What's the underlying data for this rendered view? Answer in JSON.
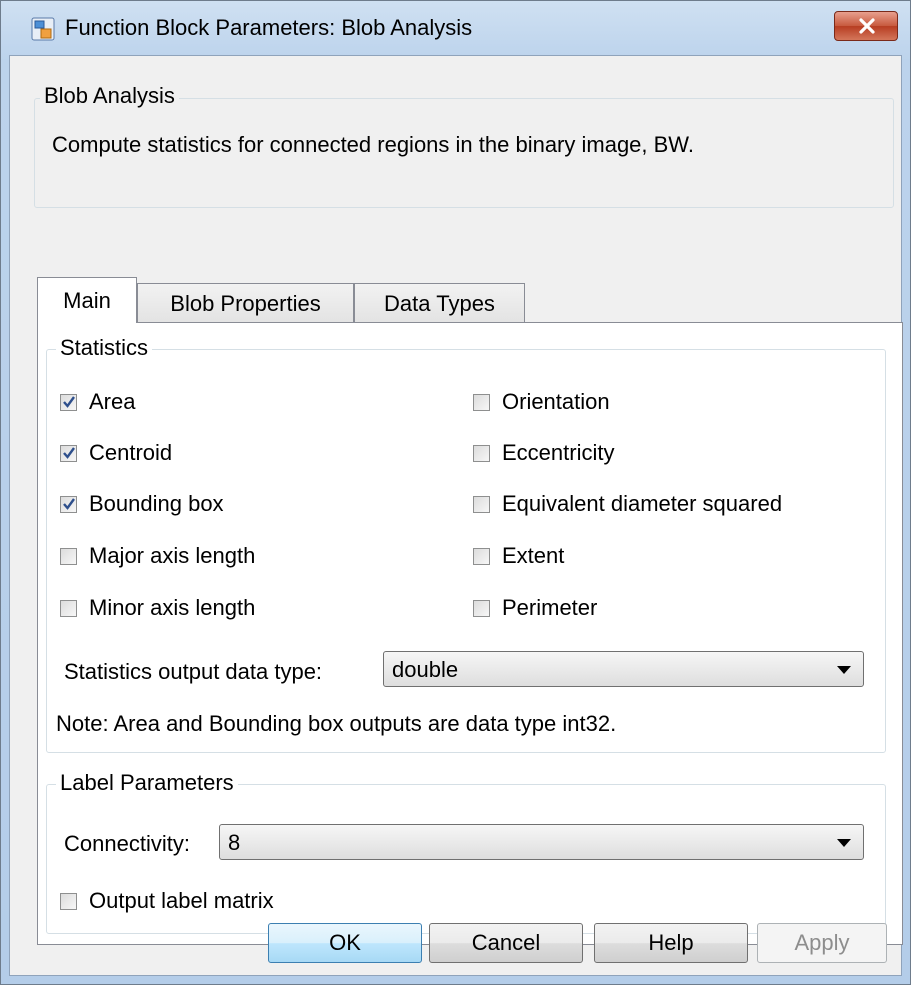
{
  "window": {
    "title": "Function Block Parameters: Blob Analysis",
    "icon": "simulink-block-icon",
    "close_icon": "close-icon"
  },
  "header_group": {
    "legend": "Blob Analysis",
    "description": "Compute statistics for connected regions in the binary image, BW."
  },
  "tabs": [
    {
      "label": "Main",
      "active": true
    },
    {
      "label": "Blob Properties",
      "active": false
    },
    {
      "label": "Data Types",
      "active": false
    }
  ],
  "statistics": {
    "legend": "Statistics",
    "left_column": [
      {
        "label": "Area",
        "checked": true
      },
      {
        "label": "Centroid",
        "checked": true
      },
      {
        "label": "Bounding box",
        "checked": true
      },
      {
        "label": "Major axis length",
        "checked": false
      },
      {
        "label": "Minor axis length",
        "checked": false
      }
    ],
    "right_column": [
      {
        "label": "Orientation",
        "checked": false
      },
      {
        "label": "Eccentricity",
        "checked": false
      },
      {
        "label": "Equivalent diameter squared",
        "checked": false
      },
      {
        "label": "Extent",
        "checked": false
      },
      {
        "label": "Perimeter",
        "checked": false
      }
    ],
    "output_type_label": "Statistics output data type:",
    "output_type_value": "double",
    "note": "Note:  Area and Bounding box outputs are data type int32."
  },
  "label_parameters": {
    "legend": "Label Parameters",
    "connectivity_label": "Connectivity:",
    "connectivity_value": "8",
    "output_label_matrix": {
      "label": "Output label matrix",
      "checked": false
    }
  },
  "buttons": {
    "ok": "OK",
    "cancel": "Cancel",
    "help": "Help",
    "apply": "Apply"
  }
}
